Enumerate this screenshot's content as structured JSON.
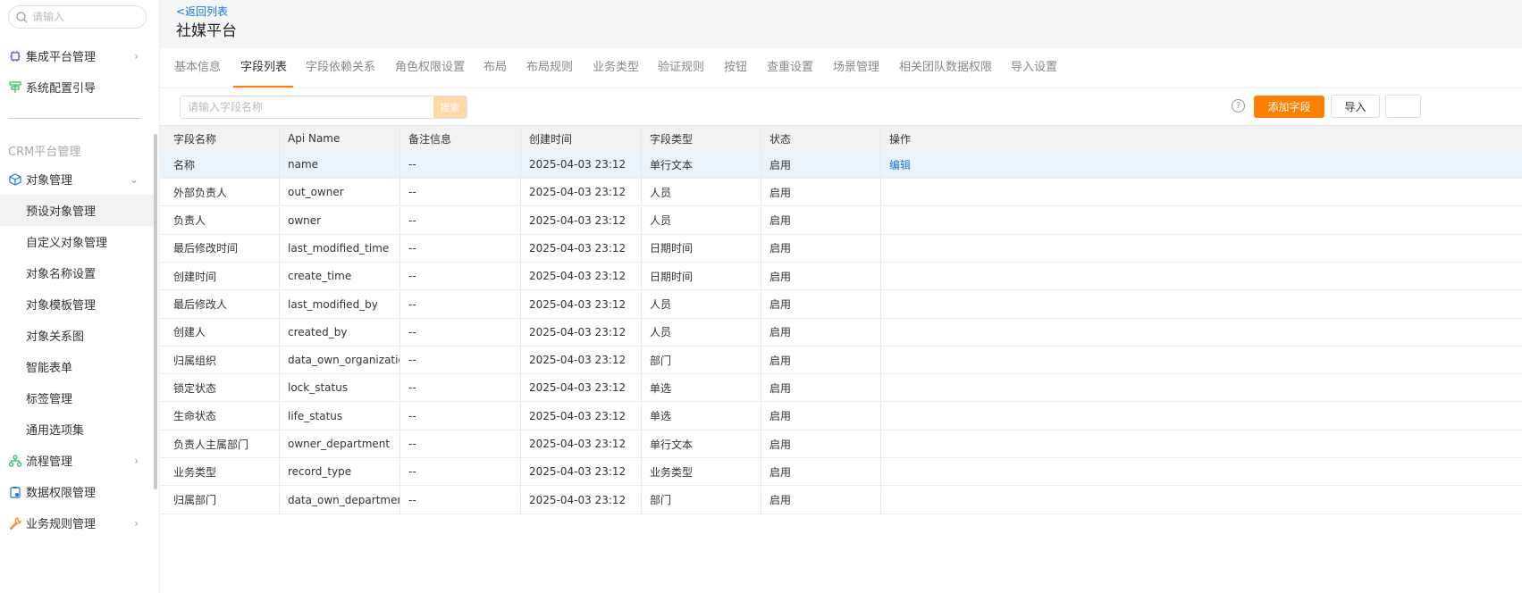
{
  "sidebar": {
    "search_placeholder": "请输入",
    "top_items": [
      {
        "label": "集成平台管理",
        "icon": "integration-icon",
        "has_chevron": true
      },
      {
        "label": "系统配置引导",
        "icon": "guide-icon",
        "has_chevron": false
      }
    ],
    "group_title": "CRM平台管理",
    "object_mgmt": {
      "label": "对象管理",
      "icon": "cube-icon"
    },
    "sub_items": [
      "预设对象管理",
      "自定义对象管理",
      "对象名称设置",
      "对象模板管理",
      "对象关系图",
      "智能表单",
      "标签管理",
      "通用选项集"
    ],
    "bottom_items": [
      {
        "label": "流程管理",
        "icon": "flow-icon",
        "has_chevron": true
      },
      {
        "label": "数据权限管理",
        "icon": "data-permission-icon",
        "has_chevron": false
      },
      {
        "label": "业务规则管理",
        "icon": "wrench-icon",
        "has_chevron": true
      }
    ]
  },
  "header": {
    "back_label": "<返回列表",
    "title": "社媒平台"
  },
  "tabs": [
    "基本信息",
    "字段列表",
    "字段依赖关系",
    "角色权限设置",
    "布局",
    "布局规则",
    "业务类型",
    "验证规则",
    "按钮",
    "查重设置",
    "场景管理",
    "相关团队数据权限",
    "导入设置"
  ],
  "active_tab": "字段列表",
  "toolbar": {
    "search_placeholder": "请输入字段名称",
    "search_button": "搜索",
    "help_symbol": "?",
    "add_button": "添加字段",
    "import_button": "导入"
  },
  "table": {
    "columns": [
      "字段名称",
      "Api Name",
      "备注信息",
      "创建时间",
      "字段类型",
      "状态",
      "操作"
    ],
    "rows": [
      [
        "名称",
        "name",
        "--",
        "2025-04-03 23:12",
        "单行文本",
        "启用",
        "编辑"
      ],
      [
        "外部负责人",
        "out_owner",
        "--",
        "2025-04-03 23:12",
        "人员",
        "启用",
        ""
      ],
      [
        "负责人",
        "owner",
        "--",
        "2025-04-03 23:12",
        "人员",
        "启用",
        ""
      ],
      [
        "最后修改时间",
        "last_modified_time",
        "--",
        "2025-04-03 23:12",
        "日期时间",
        "启用",
        ""
      ],
      [
        "创建时间",
        "create_time",
        "--",
        "2025-04-03 23:12",
        "日期时间",
        "启用",
        ""
      ],
      [
        "最后修改人",
        "last_modified_by",
        "--",
        "2025-04-03 23:12",
        "人员",
        "启用",
        ""
      ],
      [
        "创建人",
        "created_by",
        "--",
        "2025-04-03 23:12",
        "人员",
        "启用",
        ""
      ],
      [
        "归属组织",
        "data_own_organization",
        "--",
        "2025-04-03 23:12",
        "部门",
        "启用",
        ""
      ],
      [
        "锁定状态",
        "lock_status",
        "--",
        "2025-04-03 23:12",
        "单选",
        "启用",
        ""
      ],
      [
        "生命状态",
        "life_status",
        "--",
        "2025-04-03 23:12",
        "单选",
        "启用",
        ""
      ],
      [
        "负责人主属部门",
        "owner_department",
        "--",
        "2025-04-03 23:12",
        "单行文本",
        "启用",
        ""
      ],
      [
        "业务类型",
        "record_type",
        "--",
        "2025-04-03 23:12",
        "业务类型",
        "启用",
        ""
      ],
      [
        "归属部门",
        "data_own_department",
        "--",
        "2025-04-03 23:12",
        "部门",
        "启用",
        ""
      ]
    ]
  },
  "colors": {
    "accent": "#ff8000",
    "link": "#1a73e8",
    "row_highlight": "#eaf4fd"
  }
}
